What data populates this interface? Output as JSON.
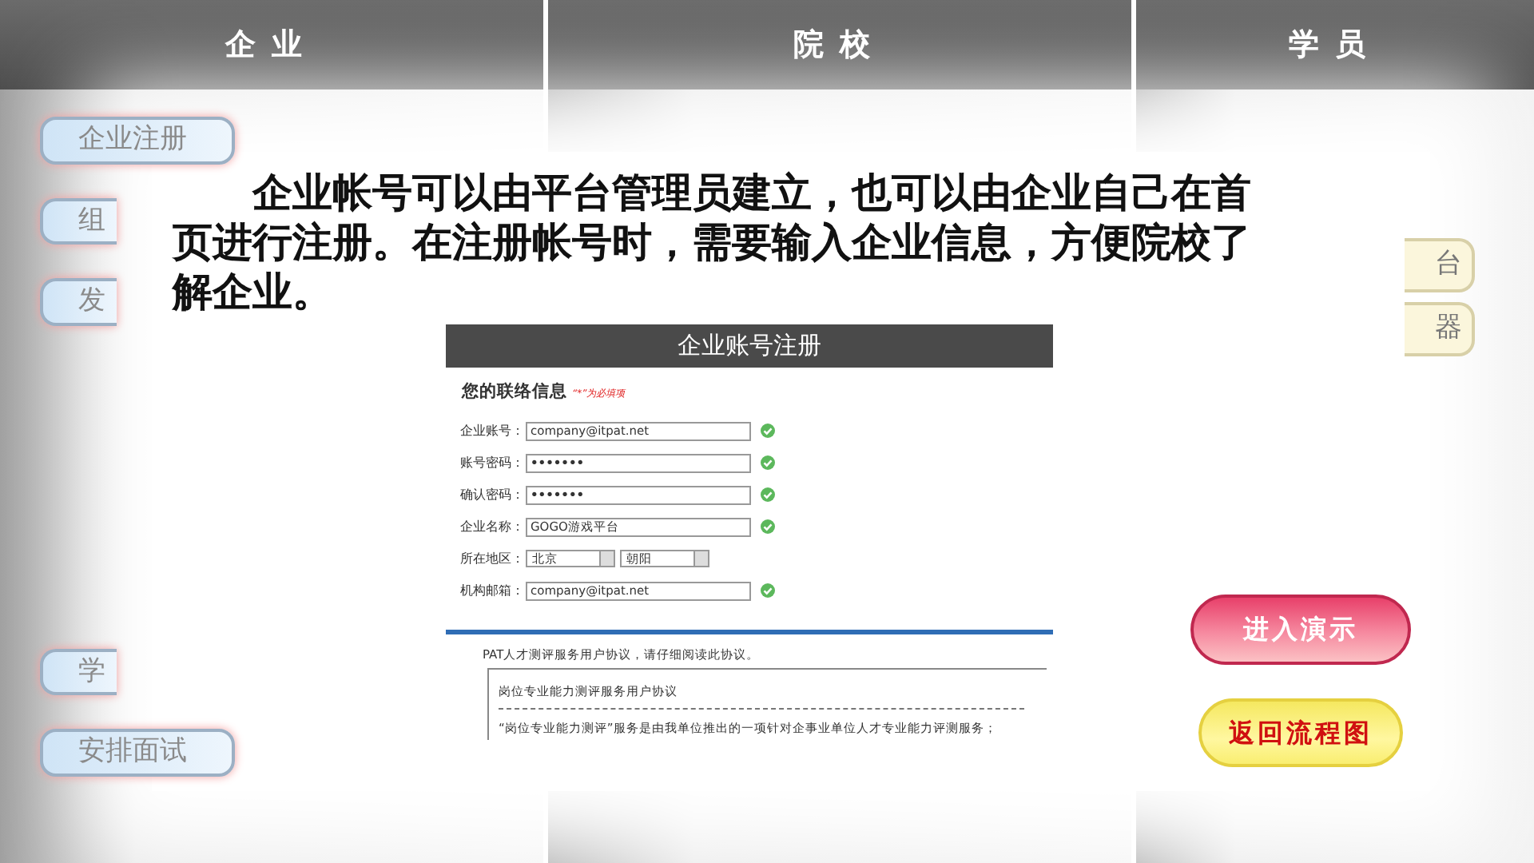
{
  "header_tabs": [
    {
      "label": "企业"
    },
    {
      "label": "院校"
    },
    {
      "label": "学员"
    }
  ],
  "left_buttons": [
    {
      "label": "企业注册"
    },
    {
      "label": "组"
    },
    {
      "label": "发"
    },
    {
      "label": "学"
    },
    {
      "label": "安排面试"
    }
  ],
  "right_buttons": [
    {
      "label": "台"
    },
    {
      "label": "器"
    }
  ],
  "description": "企业帐号可以由平台管理员建立，也可以由企业自己在首页进行注册。在注册帐号时，需要输入企业信息，方便院校了解企业。",
  "form": {
    "title": "企业账号注册",
    "section": "您的联络信息",
    "required_note": "“*”为必填项",
    "fields": [
      {
        "kind": "text",
        "label": "企业账号：",
        "value": "company@itpat.net"
      },
      {
        "kind": "password",
        "label": "账号密码：",
        "value": "•••••••"
      },
      {
        "kind": "password",
        "label": "确认密码：",
        "value": "•••••••"
      },
      {
        "kind": "text",
        "label": "企业名称：",
        "value": "GOGO游戏平台"
      },
      {
        "kind": "select",
        "label": "所在地区：",
        "options": [
          "北京",
          "朝阳"
        ]
      },
      {
        "kind": "text",
        "label": "机构邮箱：",
        "value": "company@itpat.net"
      }
    ],
    "agreement_label": "PAT人才测评服务用户协议，请仔细阅读此协议。",
    "agreement_lines": [
      "岗位专业能力测评服务用户协议",
      "“岗位专业能力测评”服务是由我单位推出的一项针对企事业单位人才专业能力评测服务；"
    ]
  },
  "action_buttons": [
    {
      "kind": "demo",
      "label": "进入演示"
    },
    {
      "kind": "back",
      "label": "返回流程图"
    }
  ]
}
